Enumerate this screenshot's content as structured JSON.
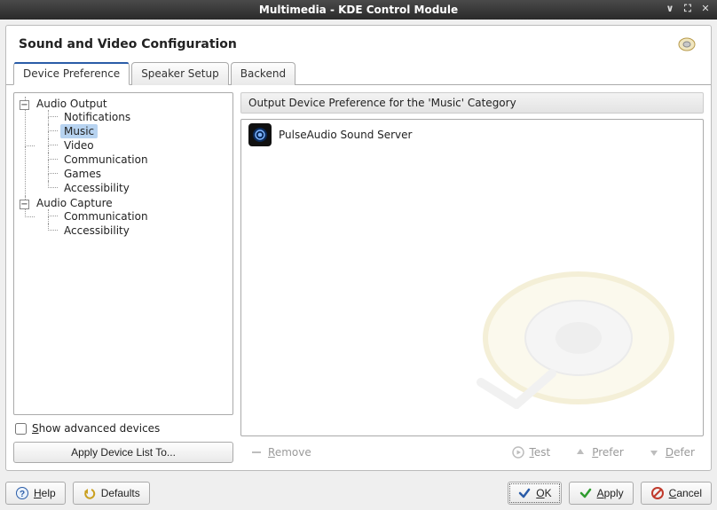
{
  "window": {
    "title": "Multimedia - KDE Control Module"
  },
  "header": {
    "title": "Sound and Video Configuration"
  },
  "tabs": [
    {
      "label": "Device Preference",
      "active": true
    },
    {
      "label": "Speaker Setup",
      "active": false
    },
    {
      "label": "Backend",
      "active": false
    }
  ],
  "tree": {
    "output": {
      "label": "Audio Output",
      "items": [
        {
          "label": "Notifications"
        },
        {
          "label": "Music",
          "selected": true
        },
        {
          "label": "Video"
        },
        {
          "label": "Communication"
        },
        {
          "label": "Games"
        },
        {
          "label": "Accessibility"
        }
      ]
    },
    "capture": {
      "label": "Audio Capture",
      "items": [
        {
          "label": "Communication"
        },
        {
          "label": "Accessibility"
        }
      ]
    }
  },
  "show_advanced": {
    "label": "Show advanced devices",
    "checked": false
  },
  "apply_list_btn": "Apply Device List To...",
  "right": {
    "section_title": "Output Device Preference for the 'Music' Category",
    "devices": [
      {
        "label": "PulseAudio Sound Server"
      }
    ]
  },
  "actions": {
    "remove": "Remove",
    "test": "Test",
    "prefer": "Prefer",
    "defer": "Defer"
  },
  "footer": {
    "help": "Help",
    "defaults": "Defaults",
    "ok": "OK",
    "apply": "Apply",
    "cancel": "Cancel"
  }
}
